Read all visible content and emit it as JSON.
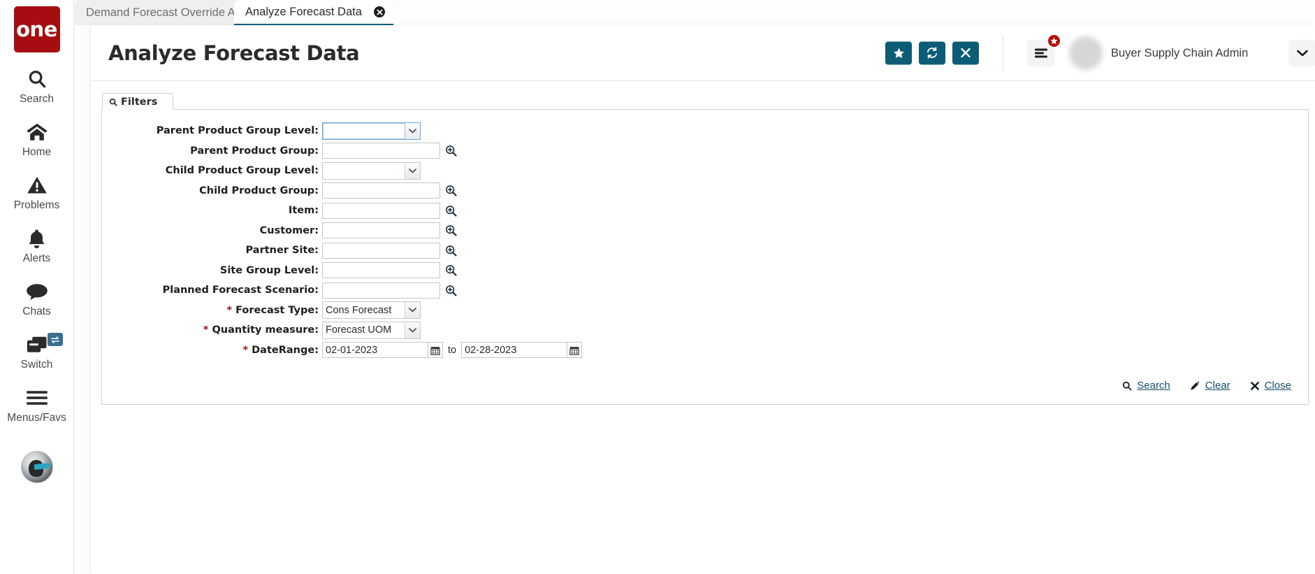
{
  "app": {
    "brand": "one",
    "accent_teal": "#0d5c75",
    "brand_red": "#a50d11",
    "link_color": "#14506b"
  },
  "sidebar": {
    "items": [
      {
        "label": "Search",
        "icon": "search-icon"
      },
      {
        "label": "Home",
        "icon": "home-icon"
      },
      {
        "label": "Problems",
        "icon": "warning-triangle-icon"
      },
      {
        "label": "Alerts",
        "icon": "bell-icon"
      },
      {
        "label": "Chats",
        "icon": "chat-bubble-icon"
      },
      {
        "label": "Switch",
        "icon": "windows-stack-icon",
        "badge_icon": "swap-arrows-icon"
      },
      {
        "label": "Menus/Favs",
        "icon": "hamburger-icon"
      }
    ],
    "assistant": {
      "icon": "ai-assistant-avatar-icon"
    }
  },
  "tabs": [
    {
      "label": "Demand Forecast Override Audit",
      "active": false,
      "close_icon": "close-circle-icon"
    },
    {
      "label": "Analyze Forecast Data",
      "active": true,
      "close_icon": "close-circle-icon"
    }
  ],
  "header": {
    "title": "Analyze Forecast Data",
    "actions": [
      {
        "name": "favorite-button",
        "icon": "star-icon"
      },
      {
        "name": "refresh-button",
        "icon": "refresh-icon"
      },
      {
        "name": "close-button",
        "icon": "x-icon"
      }
    ],
    "menus_button": {
      "icon": "menu-lines-icon",
      "badge_icon": "star-icon"
    },
    "user": {
      "name": "",
      "role": "Buyer Supply Chain Admin",
      "org": "",
      "caret_icon": "chevron-down-icon"
    }
  },
  "filters": {
    "tab_label": "Filters",
    "tab_icon": "search-icon",
    "fields": [
      {
        "label": "Parent Product Group Level:",
        "type": "select",
        "value": "",
        "required": false,
        "focused": true
      },
      {
        "label": "Parent Product Group:",
        "type": "lookup",
        "value": "",
        "required": false
      },
      {
        "label": "Child Product Group Level:",
        "type": "select",
        "value": "",
        "required": false
      },
      {
        "label": "Child Product Group:",
        "type": "lookup",
        "value": "",
        "required": false
      },
      {
        "label": "Item:",
        "type": "lookup",
        "value": "",
        "required": false
      },
      {
        "label": "Customer:",
        "type": "lookup",
        "value": "",
        "required": false
      },
      {
        "label": "Partner Site:",
        "type": "lookup",
        "value": "",
        "required": false
      },
      {
        "label": "Site Group Level:",
        "type": "lookup",
        "value": "",
        "required": false
      },
      {
        "label": "Planned Forecast Scenario:",
        "type": "lookup",
        "value": "",
        "required": false
      },
      {
        "label": "Forecast Type:",
        "type": "select",
        "value": "Cons Forecast",
        "required": true
      },
      {
        "label": "Quantity measure:",
        "type": "select",
        "value": "Forecast UOM",
        "required": true
      }
    ],
    "date_range": {
      "label": "DateRange:",
      "required": true,
      "from": "02-01-2023",
      "to_text": "to",
      "to": "02-28-2023",
      "calendar_icon": "calendar-icon"
    },
    "actions": [
      {
        "label": "Search",
        "icon": "search-icon"
      },
      {
        "label": "Clear",
        "icon": "eraser-icon"
      },
      {
        "label": "Close",
        "icon": "x-icon"
      }
    ]
  }
}
